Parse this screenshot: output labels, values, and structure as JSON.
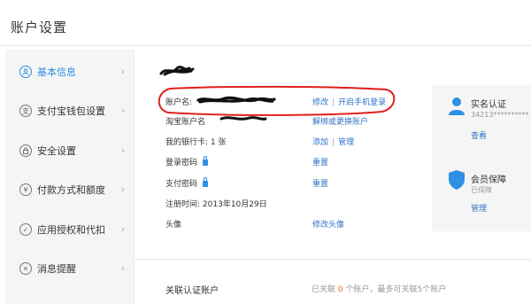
{
  "header": {
    "title": "账户设置"
  },
  "sidebar": {
    "items": [
      {
        "label": "基本信息",
        "icon": "user-icon",
        "active": true
      },
      {
        "label": "支付宝钱包设置",
        "icon": "wallet-icon"
      },
      {
        "label": "安全设置",
        "icon": "lock-icon"
      },
      {
        "label": "付款方式和额度",
        "icon": "yen-icon"
      },
      {
        "label": "应用授权和代扣",
        "icon": "check-icon"
      },
      {
        "label": "消息提醒",
        "icon": "message-icon"
      }
    ]
  },
  "main": {
    "account_name": {
      "label": "账户名:",
      "edit": "修改",
      "enable_phone_login": "开启手机登录"
    },
    "taobao_account": {
      "label": "淘宝账户名",
      "action": "解绑或更换账户"
    },
    "bank_card": {
      "label": "我的银行卡:",
      "count": "1 张",
      "add": "添加",
      "manage": "管理"
    },
    "login_password": {
      "label": "登录密码",
      "action": "重置"
    },
    "payment_password": {
      "label": "支付密码",
      "action": "重置"
    },
    "register_time": {
      "label": "注册时间:",
      "value": "2013年10月29日"
    },
    "avatar": {
      "label": "头像",
      "action": "修改头像"
    },
    "linked": {
      "label": "关联认证账户",
      "info_prefix": "已关联",
      "count": "0",
      "info_suffix": "个账户，最多可关联5个账户"
    }
  },
  "right_panel": {
    "verify": {
      "title": "实名认证",
      "id": "34213**********",
      "link": "查看"
    },
    "member": {
      "title": "会员保障",
      "status": "已保障",
      "link": "管理"
    }
  },
  "colors": {
    "accent": "#2f8ee5",
    "link": "#2f73c8",
    "highlight": "#ff6600",
    "annotation": "#e0201b"
  }
}
